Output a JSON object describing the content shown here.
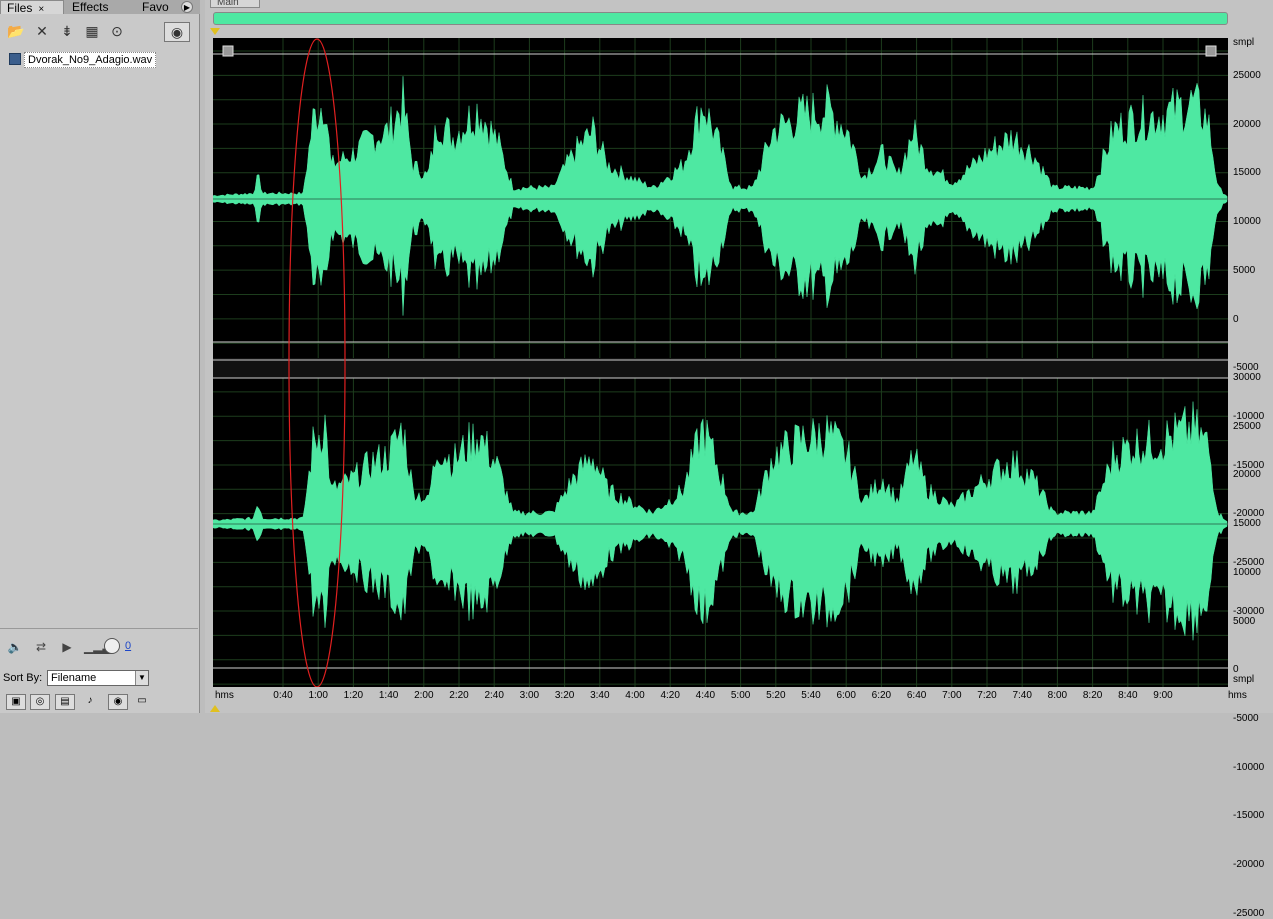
{
  "panel": {
    "tabs": [
      {
        "label": "Files",
        "close": "×"
      },
      {
        "label": "Effects"
      },
      {
        "label": "Favo"
      }
    ],
    "file": "Dvorak_No9_Adagio.wav",
    "volume_value": "0",
    "sort_label": "Sort By:",
    "sort_value": "Filename"
  },
  "editor": {
    "tab_label": "Main",
    "waveform_color": "#4ee8a2",
    "selection_color": "#e02020",
    "y_unit": "smpl",
    "time_unit": "hms",
    "y_labels": [
      "25000",
      "20000",
      "15000",
      "10000",
      "5000",
      "0",
      "-5000",
      "-10000",
      "-15000",
      "-20000",
      "-25000",
      "-30000"
    ],
    "y_labels_2": [
      "30000",
      "25000",
      "20000",
      "15000",
      "10000",
      "5000",
      "0",
      "-5000",
      "-10000",
      "-15000",
      "-20000",
      "-25000"
    ],
    "time_labels": [
      "0:40",
      "1:00",
      "1:20",
      "1:40",
      "2:00",
      "2:20",
      "2:40",
      "3:00",
      "3:20",
      "3:40",
      "4:00",
      "4:20",
      "4:40",
      "5:00",
      "5:20",
      "5:40",
      "6:00",
      "6:20",
      "6:40",
      "7:00",
      "7:20",
      "7:40",
      "8:00",
      "8:20",
      "8:40",
      "9:00"
    ]
  }
}
